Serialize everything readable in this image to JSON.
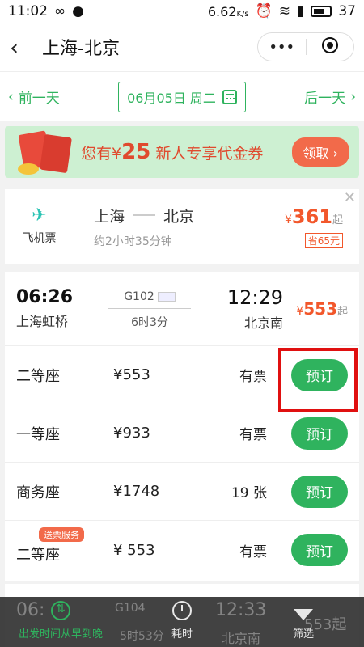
{
  "status_bar": {
    "time": "11:02",
    "speed": "6.62",
    "speed_unit": "K/s",
    "battery": "37"
  },
  "header": {
    "title": "上海-北京",
    "more": "•••"
  },
  "date_nav": {
    "prev": "前一天",
    "date": "06月05日 周二",
    "next": "后一天"
  },
  "coupon": {
    "prefix": "您有",
    "currency": "¥",
    "amount": "25",
    "suffix": "新人专享代金券",
    "button": "领取"
  },
  "flight": {
    "label": "飞机票",
    "from": "上海",
    "to": "北京",
    "duration": "约2小时35分钟",
    "currency": "¥",
    "price": "361",
    "price_unit": "起",
    "saving": "省65元"
  },
  "train": {
    "dep_time": "06:26",
    "dep_station": "上海虹桥",
    "train_no": "G102",
    "duration": "6时3分",
    "arr_time": "12:29",
    "arr_station": "北京南",
    "currency": "¥",
    "min_price": "553",
    "price_unit": "起",
    "seats": [
      {
        "name": "二等座",
        "price": "¥553",
        "stock": "有票",
        "button": "预订"
      },
      {
        "name": "一等座",
        "price": "¥933",
        "stock": "有票",
        "button": "预订"
      },
      {
        "name": "商务座",
        "price": "¥1748",
        "stock": "19 张",
        "button": "预订"
      },
      {
        "name": "二等座",
        "price": "¥ 553",
        "stock": "有票",
        "button": "预订",
        "tag": "送票服务"
      }
    ]
  },
  "next_train": {
    "dep_time": "06:",
    "train_no": "G104",
    "duration": "5时53分",
    "arr_time": "12:33",
    "arr_station": "北京南",
    "price": "553起"
  },
  "bottom_bar": {
    "items": [
      {
        "label": "出发时间从早到晚",
        "icon": "sort-icon",
        "active": true
      },
      {
        "label": "耗时",
        "icon": "clock-icon",
        "active": false
      },
      {
        "label": "筛选",
        "icon": "filter-icon",
        "active": false
      }
    ]
  },
  "colors": {
    "green": "#2fb35e",
    "orange": "#f2572b",
    "highlight": "#e01010"
  }
}
